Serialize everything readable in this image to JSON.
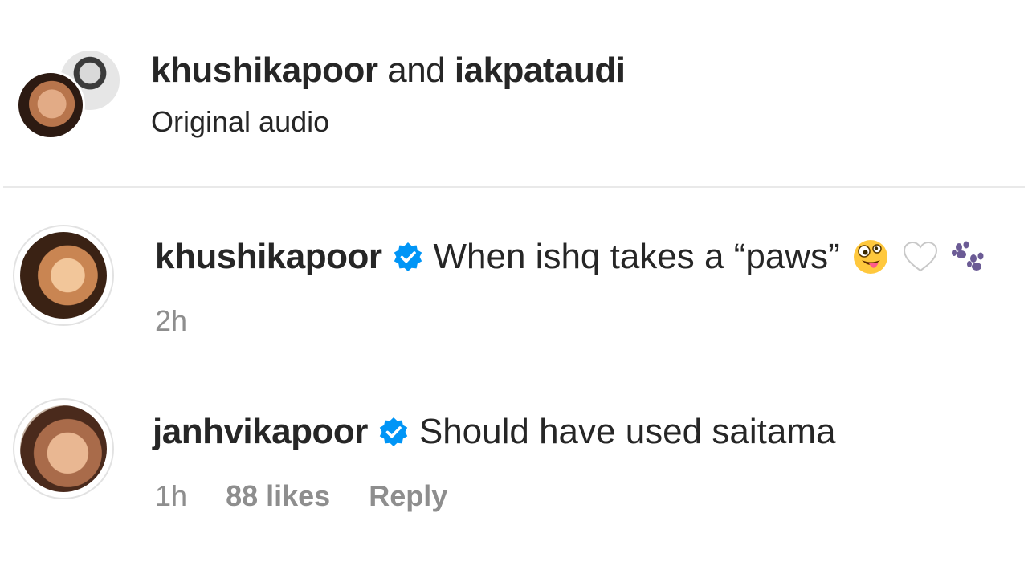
{
  "header": {
    "user1": "khushikapoor",
    "conjunction": "and",
    "user2": "iakpataudi",
    "audio_label": "Original audio"
  },
  "comments": [
    {
      "username": "khushikapoor",
      "verified": true,
      "text": "When ishq takes a “paws”",
      "emojis": [
        "zany-face",
        "white-heart",
        "paw-prints"
      ],
      "time": "2h"
    },
    {
      "username": "janhvikapoor",
      "verified": true,
      "text": "Should have used saitama",
      "time": "1h",
      "likes": "88 likes",
      "reply_label": "Reply"
    }
  ],
  "colors": {
    "text": "#262626",
    "muted": "#8e8e8e",
    "verified_blue": "#0095f6",
    "divider": "#e9e9e9"
  }
}
